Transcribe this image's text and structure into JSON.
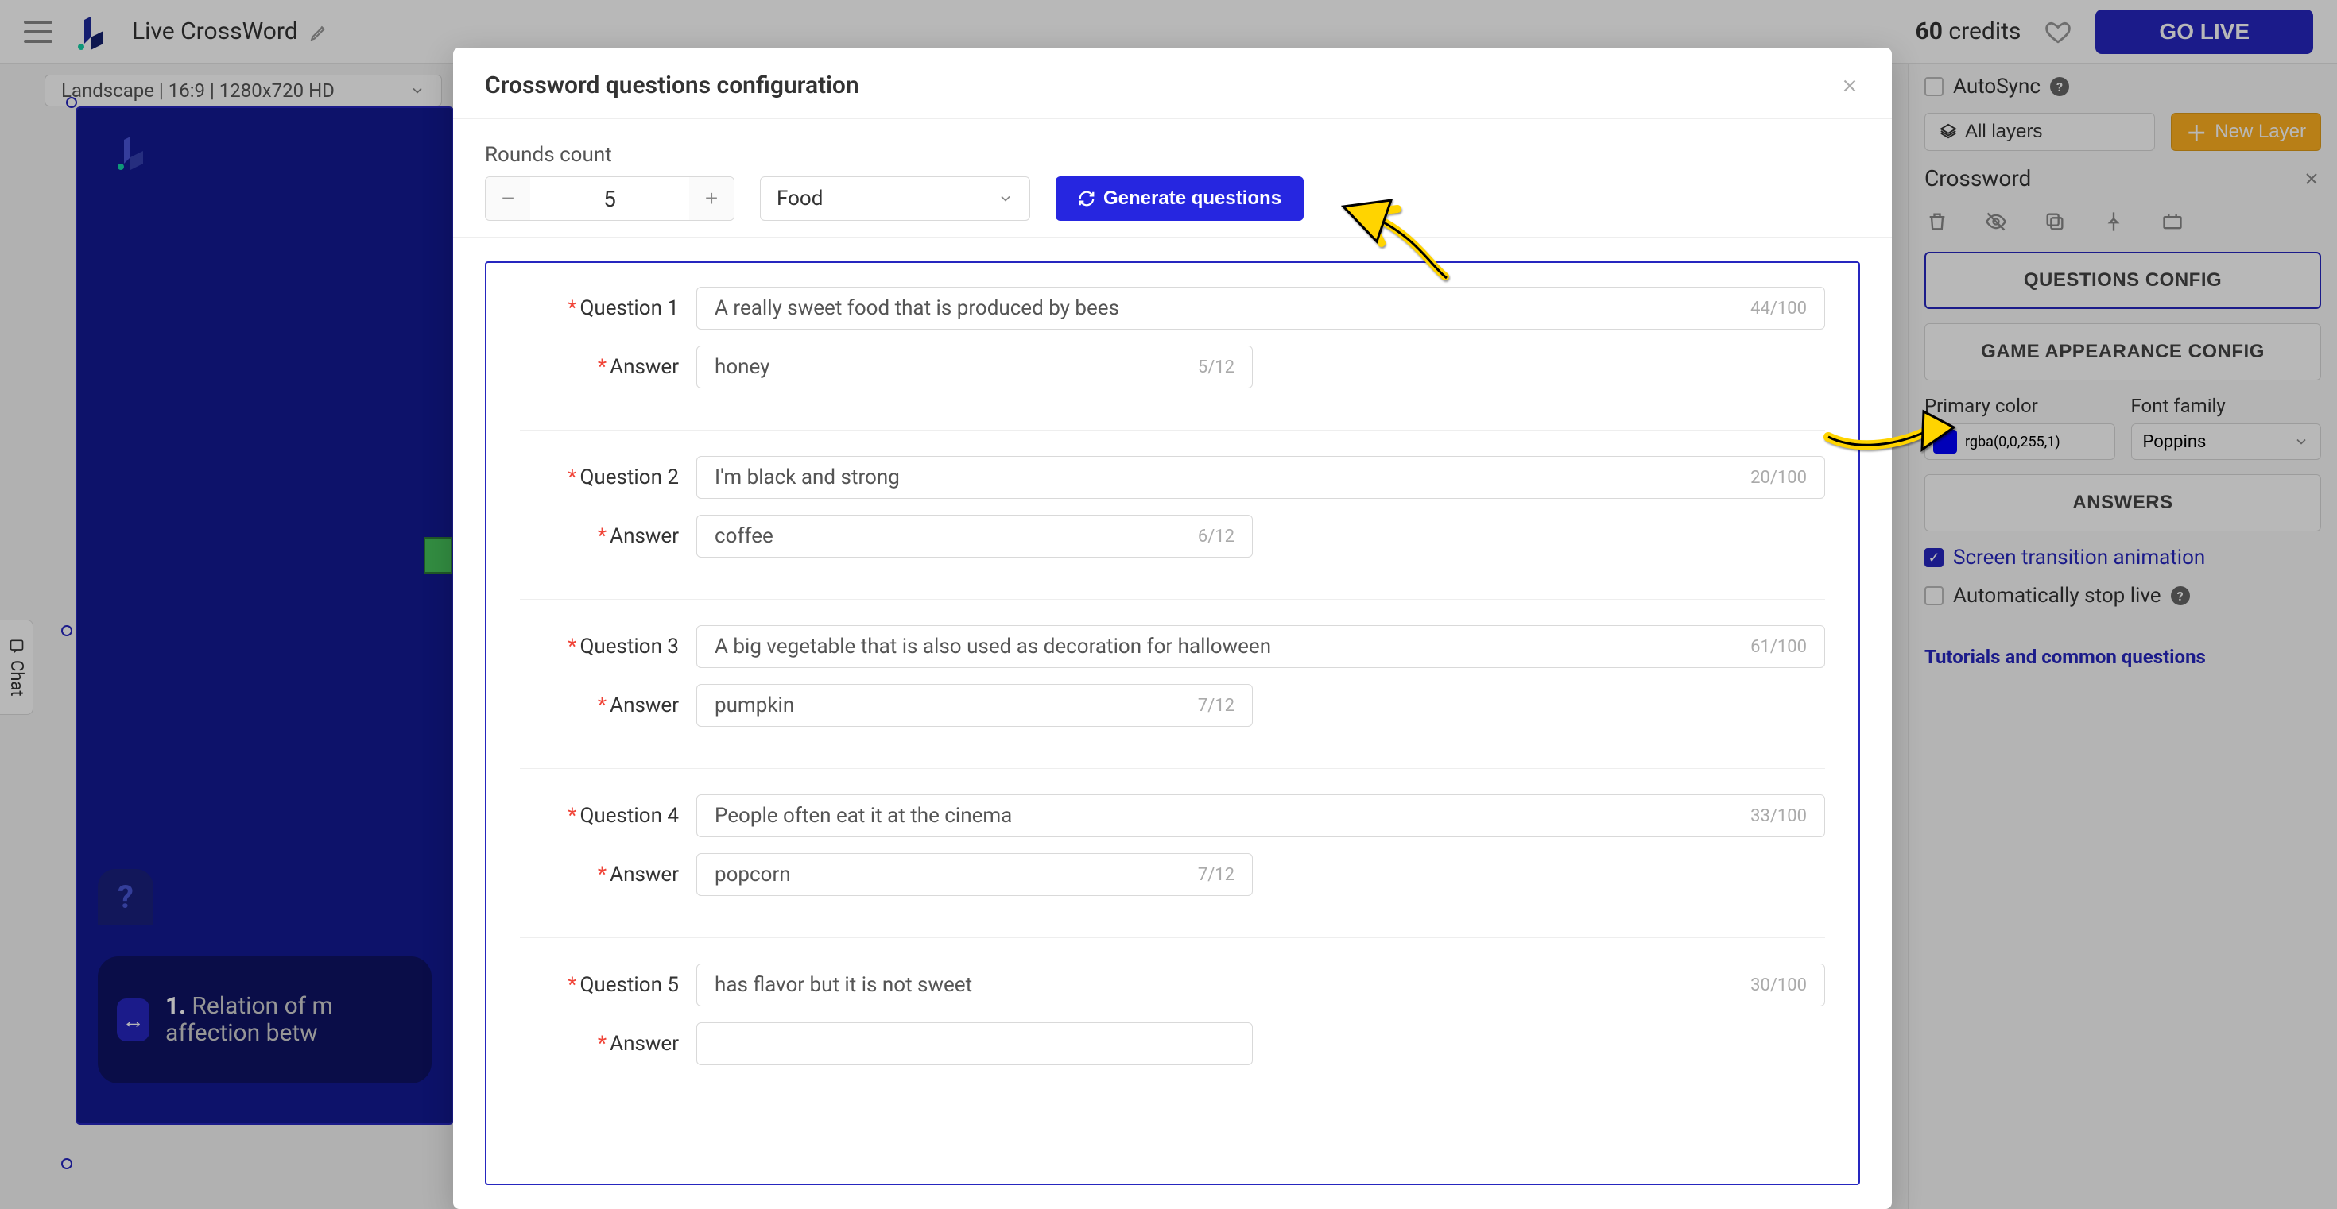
{
  "header": {
    "title": "Live CrossWord",
    "credits_count": "60",
    "credits_label": "credits",
    "go_live": "GO LIVE",
    "aspect": "Landscape | 16:9 | 1280x720 HD"
  },
  "chat_tab": "Chat",
  "canvas": {
    "hint_icon": "?",
    "caption_num": "1.",
    "caption_text": "Relation of m affection betw"
  },
  "right": {
    "autosync": "AutoSync",
    "all_layers": "All layers",
    "new_layer": "New Layer",
    "layer_title": "Crossword",
    "questions_config": "QUESTIONS CONFIG",
    "appearance_config": "GAME APPEARANCE CONFIG",
    "primary_color_label": "Primary color",
    "primary_color_value": "rgba(0,0,255,1)",
    "primary_color_hex": "#0000ff",
    "font_label": "Font family",
    "font_value": "Poppins",
    "answers": "ANSWERS",
    "transition": "Screen transition animation",
    "auto_stop": "Automatically stop live",
    "tutorials": "Tutorials and common questions"
  },
  "modal": {
    "title": "Crossword questions configuration",
    "rounds_label": "Rounds count",
    "rounds_value": "5",
    "category": "Food",
    "generate": "Generate questions",
    "question_label": "Question",
    "answer_label": "Answer",
    "q_max": "100",
    "a_max": "12",
    "items": [
      {
        "q": "A really sweet food that is produced by bees",
        "qn": "44",
        "a": "honey",
        "an": "5"
      },
      {
        "q": "I'm black and strong",
        "qn": "20",
        "a": "coffee",
        "an": "6"
      },
      {
        "q": "A big vegetable that is also used as decoration for halloween",
        "qn": "61",
        "a": "pumpkin",
        "an": "7"
      },
      {
        "q": "People often eat it at the cinema",
        "qn": "33",
        "a": "popcorn",
        "an": "7"
      },
      {
        "q": "has flavor but it is not sweet",
        "qn": "30",
        "a": "",
        "an": ""
      }
    ]
  }
}
